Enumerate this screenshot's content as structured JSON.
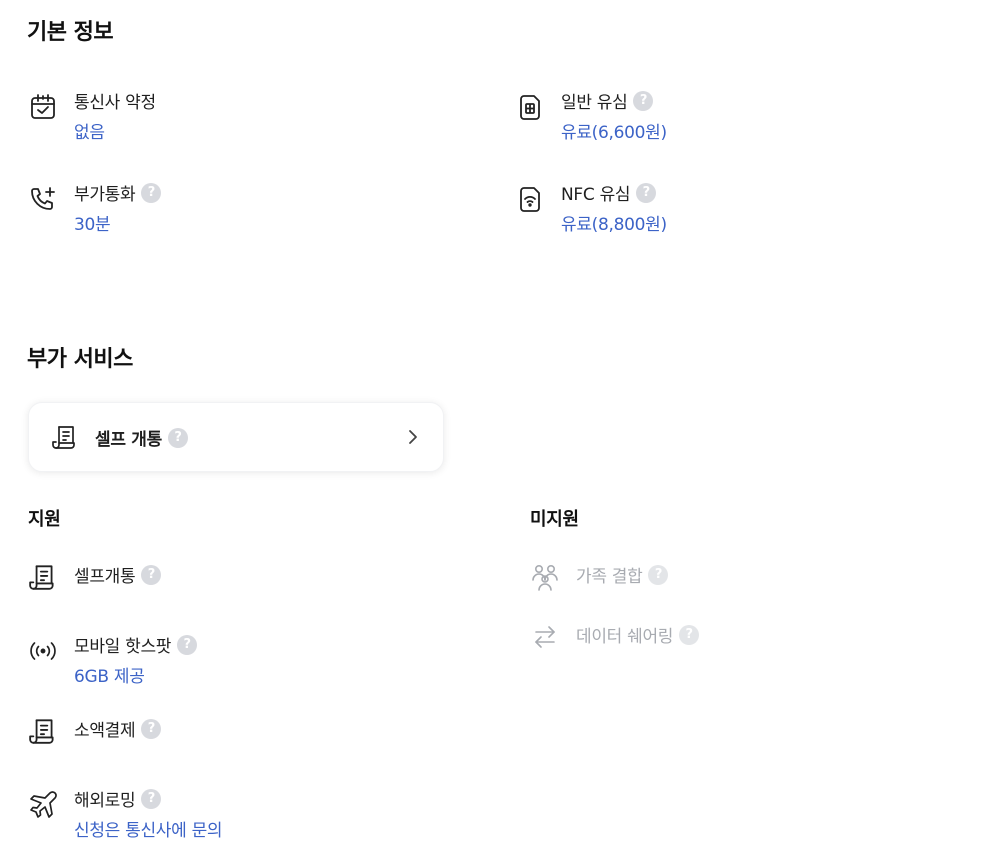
{
  "basic_info": {
    "title": "기본 정보",
    "contract": {
      "label": "통신사 약정",
      "value": "없음",
      "icon": "calendar-check-icon"
    },
    "usim": {
      "label": "일반 유심",
      "value": "유료(6,600원)",
      "icon": "sim-card-icon"
    },
    "extra_call": {
      "label": "부가통화",
      "value": "30분",
      "icon": "phone-plus-icon"
    },
    "nfc_usim": {
      "label": "NFC 유심",
      "value": "유료(8,800원)",
      "icon": "nfc-sim-icon"
    }
  },
  "additional_services": {
    "title": "부가 서비스",
    "card": {
      "label": "셀프 개통",
      "icon": "receipt-icon"
    },
    "supported": {
      "title": "지원",
      "items": [
        {
          "label": "셀프개통",
          "value": "",
          "icon": "receipt-icon"
        },
        {
          "label": "모바일 핫스팟",
          "value": "6GB 제공",
          "icon": "hotspot-icon"
        },
        {
          "label": "소액결제",
          "value": "",
          "icon": "receipt-icon"
        },
        {
          "label": "해외로밍",
          "value": "신청은 통신사에 문의",
          "icon": "airplane-icon"
        }
      ]
    },
    "unsupported": {
      "title": "미지원",
      "items": [
        {
          "label": "가족 결합",
          "icon": "family-icon"
        },
        {
          "label": "데이터 쉐어링",
          "icon": "swap-arrows-icon"
        }
      ]
    }
  },
  "help_mark": "?",
  "colors": {
    "accent": "#3c63c7",
    "muted": "#a8abb1",
    "help": "#d7d9de"
  }
}
